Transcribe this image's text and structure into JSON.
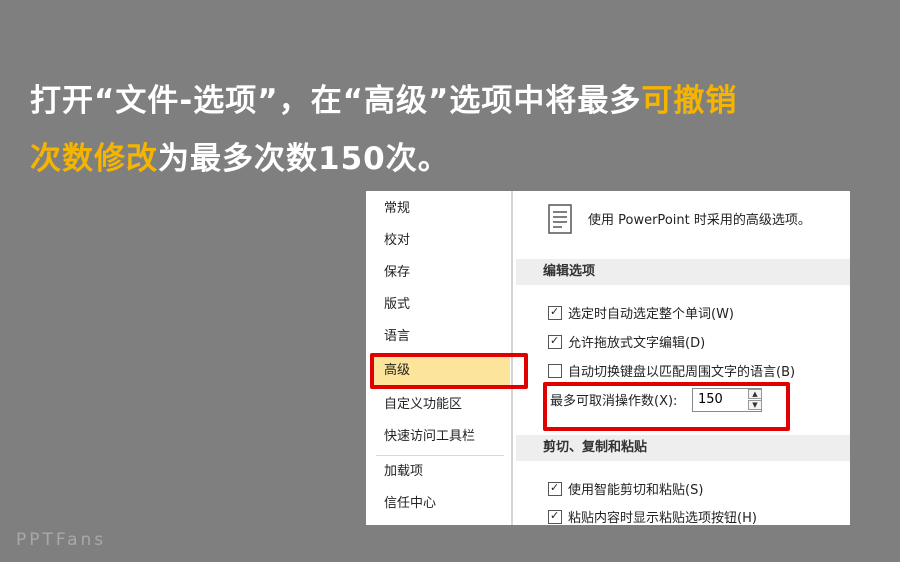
{
  "headline": {
    "line1_pre": "打开“文件-选项”，在“高级”选项中将最多",
    "line1_hl": "可撤销",
    "line2_hl": "次数修改",
    "line2_post": "为最多次数150次。"
  },
  "nav": {
    "items": [
      {
        "label": "常规"
      },
      {
        "label": "校对"
      },
      {
        "label": "保存"
      },
      {
        "label": "版式"
      },
      {
        "label": "语言"
      },
      {
        "label": "高级"
      },
      {
        "label": "自定义功能区"
      },
      {
        "label": "快速访问工具栏"
      },
      {
        "label": "加载项"
      },
      {
        "label": "信任中心"
      }
    ],
    "selected": "高级"
  },
  "content": {
    "intro": "使用 PowerPoint 时采用的高级选项。",
    "section_editing": "编辑选项",
    "options_editing": [
      {
        "label": "选定时自动选定整个单词(W)",
        "checked": true
      },
      {
        "label": "允许拖放式文字编辑(D)",
        "checked": true
      },
      {
        "label": "自动切换键盘以匹配周围文字的语言(B)",
        "checked": false
      }
    ],
    "undo_label": "最多可取消操作数(X):",
    "undo_value": "150",
    "section_clipboard": "剪切、复制和粘贴",
    "options_clipboard": [
      {
        "label": "使用智能剪切和粘贴(S)",
        "checked": true
      },
      {
        "label": "粘贴内容时显示粘贴选项按钮(H)",
        "checked": true
      }
    ]
  },
  "watermark": "PPTFans",
  "colors": {
    "background": "#7f7f7f",
    "highlight_text": "#f5b400",
    "highlight_box": "#e00000",
    "selected_nav": "#fce49b"
  }
}
